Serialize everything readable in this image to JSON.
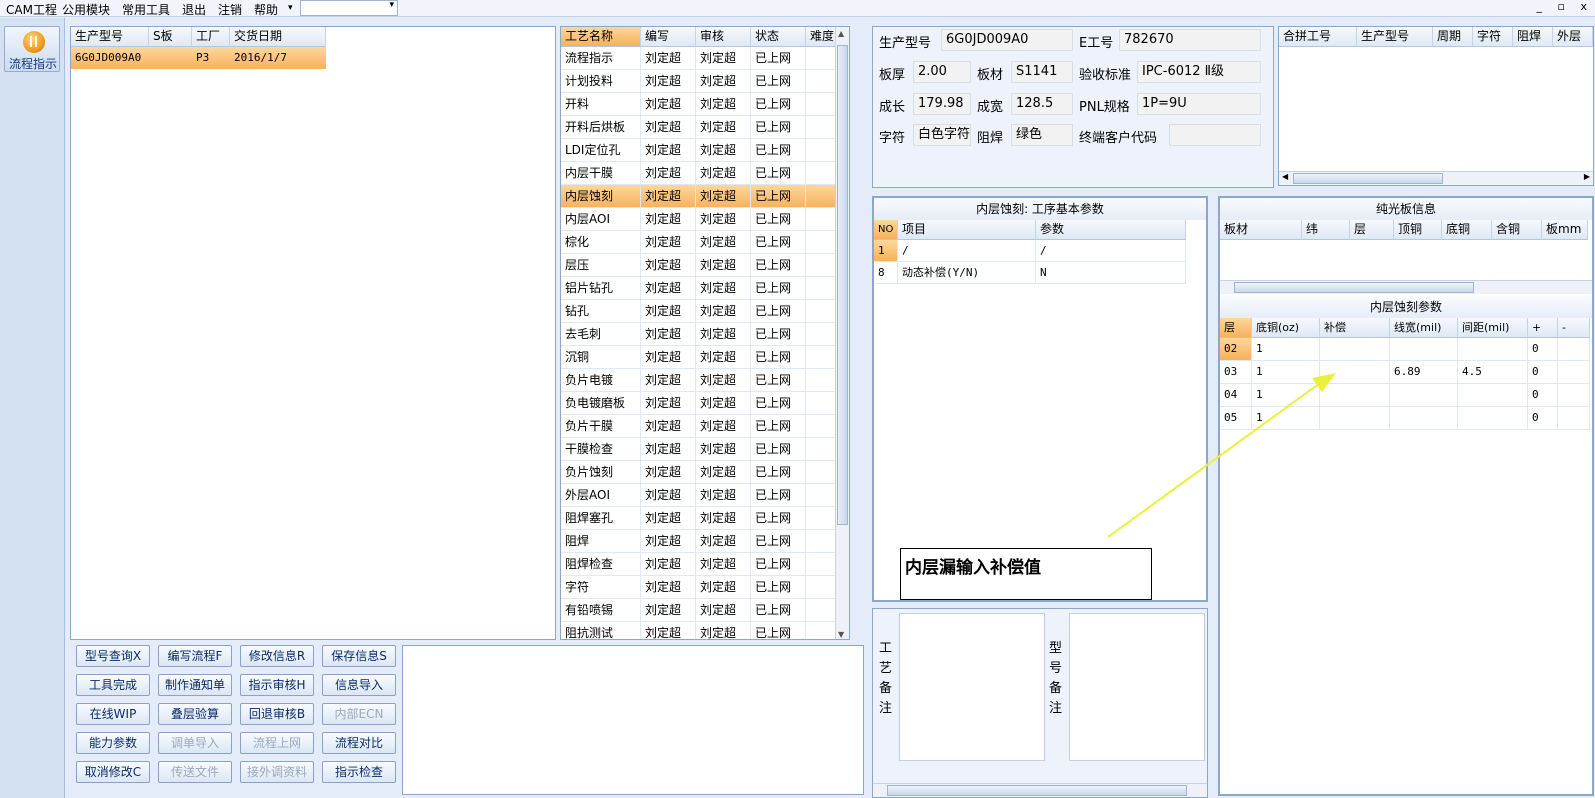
{
  "menu": {
    "items": [
      "CAM工程",
      "公用模块",
      "常用工具",
      "退出",
      "注销",
      "帮助"
    ],
    "win_controls": "_ ▫ x"
  },
  "sidebar": {
    "flow_button": "流程指示"
  },
  "job_table": {
    "headers": [
      "生产型号",
      "S板",
      "工厂",
      "交货日期"
    ],
    "rows": [
      [
        "6G0JD009A0",
        "",
        "P3",
        "2016/1/7"
      ]
    ]
  },
  "process_table": {
    "headers": [
      "工艺名称",
      "编写",
      "审核",
      "状态",
      "难度"
    ],
    "selected_index": 6,
    "rows": [
      [
        "流程指示",
        "刘定超",
        "刘定超",
        "已上网",
        ""
      ],
      [
        "计划投料",
        "刘定超",
        "刘定超",
        "已上网",
        ""
      ],
      [
        "开料",
        "刘定超",
        "刘定超",
        "已上网",
        ""
      ],
      [
        "开料后烘板",
        "刘定超",
        "刘定超",
        "已上网",
        ""
      ],
      [
        "LDI定位孔",
        "刘定超",
        "刘定超",
        "已上网",
        ""
      ],
      [
        "内层干膜",
        "刘定超",
        "刘定超",
        "已上网",
        ""
      ],
      [
        "内层蚀刻",
        "刘定超",
        "刘定超",
        "已上网",
        ""
      ],
      [
        "内层AOI",
        "刘定超",
        "刘定超",
        "已上网",
        ""
      ],
      [
        "棕化",
        "刘定超",
        "刘定超",
        "已上网",
        ""
      ],
      [
        "层压",
        "刘定超",
        "刘定超",
        "已上网",
        ""
      ],
      [
        "铝片钻孔",
        "刘定超",
        "刘定超",
        "已上网",
        ""
      ],
      [
        "钻孔",
        "刘定超",
        "刘定超",
        "已上网",
        ""
      ],
      [
        "去毛刺",
        "刘定超",
        "刘定超",
        "已上网",
        ""
      ],
      [
        "沉铜",
        "刘定超",
        "刘定超",
        "已上网",
        ""
      ],
      [
        "负片电镀",
        "刘定超",
        "刘定超",
        "已上网",
        ""
      ],
      [
        "负电镀磨板",
        "刘定超",
        "刘定超",
        "已上网",
        ""
      ],
      [
        "负片干膜",
        "刘定超",
        "刘定超",
        "已上网",
        ""
      ],
      [
        "干膜检查",
        "刘定超",
        "刘定超",
        "已上网",
        ""
      ],
      [
        "负片蚀刻",
        "刘定超",
        "刘定超",
        "已上网",
        ""
      ],
      [
        "外层AOI",
        "刘定超",
        "刘定超",
        "已上网",
        ""
      ],
      [
        "阻焊塞孔",
        "刘定超",
        "刘定超",
        "已上网",
        ""
      ],
      [
        "阻焊",
        "刘定超",
        "刘定超",
        "已上网",
        ""
      ],
      [
        "阻焊检查",
        "刘定超",
        "刘定超",
        "已上网",
        ""
      ],
      [
        "字符",
        "刘定超",
        "刘定超",
        "已上网",
        ""
      ],
      [
        "有铅喷锡",
        "刘定超",
        "刘定超",
        "已上网",
        ""
      ],
      [
        "阻抗测试",
        "刘定超",
        "刘定超",
        "已上网",
        ""
      ]
    ]
  },
  "buttons": [
    {
      "label": "型号查询X",
      "enabled": true
    },
    {
      "label": "编写流程F",
      "enabled": true
    },
    {
      "label": "修改信息R",
      "enabled": true
    },
    {
      "label": "保存信息S",
      "enabled": true
    },
    {
      "label": "工具完成",
      "enabled": true
    },
    {
      "label": "制作通知单",
      "enabled": true
    },
    {
      "label": "指示审核H",
      "enabled": true
    },
    {
      "label": "信息导入",
      "enabled": true
    },
    {
      "label": "在线WIP",
      "enabled": true
    },
    {
      "label": "叠层验算",
      "enabled": true
    },
    {
      "label": "回退审核B",
      "enabled": true
    },
    {
      "label": "内部ECN",
      "enabled": false
    },
    {
      "label": "能力参数",
      "enabled": true
    },
    {
      "label": "调单导入",
      "enabled": false
    },
    {
      "label": "流程上网",
      "enabled": false
    },
    {
      "label": "流程对比",
      "enabled": true
    },
    {
      "label": "取消修改C",
      "enabled": true
    },
    {
      "label": "传送文件",
      "enabled": false
    },
    {
      "label": "接外调资料",
      "enabled": false
    },
    {
      "label": "指示检查",
      "enabled": true
    }
  ],
  "info": {
    "model_label": "生产型号",
    "model_value": "6G0JD009A0",
    "eno_label": "E工号",
    "eno_value": "782670",
    "thick_label": "板厚",
    "thick_value": "2.00",
    "mat_label": "板材",
    "mat_value": "S1141",
    "std_label": "验收标准",
    "std_value": "IPC-6012 Ⅱ级",
    "len_label": "成长",
    "len_value": "179.98",
    "wid_label": "成宽",
    "wid_value": "128.5",
    "pnl_label": "PNL规格",
    "pnl_value": "1P=9U",
    "char_label": "字符",
    "char_value": "白色字符",
    "mask_label": "阻焊",
    "mask_value": "绿色",
    "cust_label": "终端客户代码",
    "cust_value": ""
  },
  "merge_table": {
    "headers": [
      "合拼工号",
      "生产型号",
      "周期",
      "字符",
      "阻焊",
      "外层"
    ]
  },
  "basic_params": {
    "title": "内层蚀刻: 工序基本参数",
    "headers": [
      "NO",
      "项目",
      "参数"
    ],
    "rows": [
      [
        "1",
        "/",
        "/"
      ],
      [
        "8",
        "动态补偿(Y/N)",
        "N"
      ]
    ]
  },
  "plain_board": {
    "title": "纯光板信息",
    "headers": [
      "板材",
      "纬",
      "层",
      "顶铜",
      "底铜",
      "含铜",
      "板mm"
    ]
  },
  "etch_params": {
    "title": "内层蚀刻参数",
    "headers": [
      "层",
      "底铜(oz)",
      "补偿",
      "线宽(mil)",
      "间距(mil)",
      "+",
      "-"
    ],
    "rows": [
      [
        "02",
        "1",
        "",
        "",
        "",
        "0",
        ""
      ],
      [
        "03",
        "1",
        "",
        "6.89",
        "4.5",
        "0",
        ""
      ],
      [
        "04",
        "1",
        "",
        "",
        "",
        "0",
        ""
      ],
      [
        "05",
        "1",
        "",
        "",
        "",
        "0",
        ""
      ]
    ]
  },
  "remarks": {
    "process_label": "工艺备注",
    "model_label": "型号备注"
  },
  "annotation": {
    "text": "内层漏输入补偿值",
    "color": "#e8f23a"
  }
}
